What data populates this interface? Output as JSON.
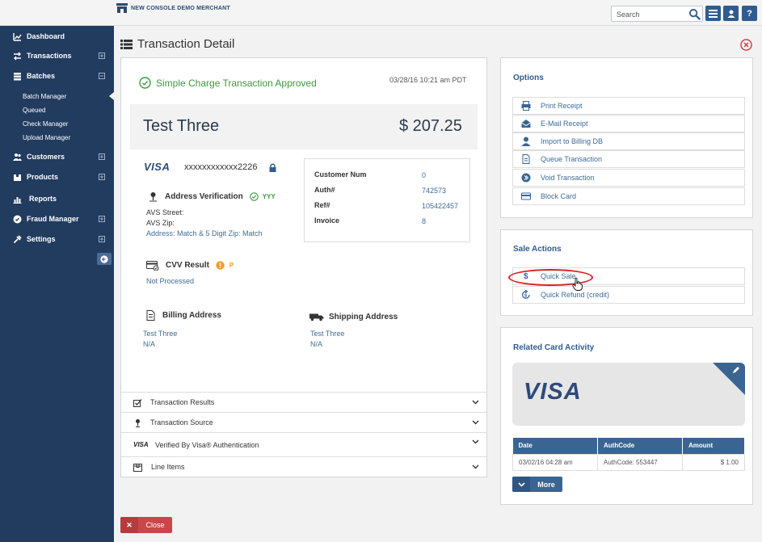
{
  "app": {
    "merchant_name": "NEW CONSOLE DEMO MERCHANT",
    "search_placeholder": "Search"
  },
  "sidebar": {
    "items": [
      {
        "label": "Dashboard",
        "icon": "chart-icon"
      },
      {
        "label": "Transactions",
        "icon": "arrows-icon"
      },
      {
        "label": "Batches",
        "icon": "stack-icon"
      },
      {
        "label": "Customers",
        "icon": "users-icon"
      },
      {
        "label": "Products",
        "icon": "box-icon"
      },
      {
        "label": "Reports",
        "icon": "bar-chart-icon"
      },
      {
        "label": "Fraud Manager",
        "icon": "shield-icon"
      },
      {
        "label": "Settings",
        "icon": "wrench-icon"
      }
    ],
    "batch_sub_items": [
      "Batch Manager",
      "Queued",
      "Check Manager",
      "Upload Manager"
    ]
  },
  "page": {
    "title": "Transaction Detail"
  },
  "transaction": {
    "status": "Simple Charge Transaction Approved",
    "timestamp": "03/28/16 10:21 am PDT",
    "customer_name": "Test Three",
    "amount": "$ 207.25",
    "card_brand": "VISA",
    "card_number": "xxxxxxxxxxxx2226",
    "address_verification": {
      "title": "Address Verification",
      "code": "YYY",
      "street_label": "AVS Street:",
      "zip_label": "AVS Zip:",
      "result": "Address: Match & 5 Digit Zip: Match"
    },
    "cvv": {
      "title": "CVV Result",
      "code": "P",
      "result": "Not Processed"
    },
    "billing": {
      "title": "Billing Address",
      "name": "Test  Three",
      "line2": "N/A"
    },
    "shipping": {
      "title": "Shipping Address",
      "name": "Test  Three",
      "line2": "N/A"
    },
    "info": [
      {
        "label": "Customer Num",
        "value": "0"
      },
      {
        "label": "Auth#",
        "value": "742573"
      },
      {
        "label": "Ref#",
        "value": "105422457"
      },
      {
        "label": "Invoice",
        "value": "8"
      }
    ],
    "accordion": [
      {
        "label": "Transaction Results",
        "icon": "checkbox-icon"
      },
      {
        "label": "Transaction Source",
        "icon": "pin-icon"
      },
      {
        "label": "Verified By Visa® Authentication",
        "icon": "visa-icon"
      },
      {
        "label": "Line Items",
        "icon": "box-icon"
      }
    ],
    "close_label": "Close"
  },
  "options": {
    "title": "Options",
    "items": [
      {
        "label": "Print Receipt",
        "icon": "printer-icon"
      },
      {
        "label": "E-Mail Receipt",
        "icon": "envelope-icon"
      },
      {
        "label": "Import to Billing DB",
        "icon": "user-icon"
      },
      {
        "label": "Queue Transaction",
        "icon": "document-icon"
      },
      {
        "label": "Void Transaction",
        "icon": "void-icon"
      },
      {
        "label": "Block Card",
        "icon": "card-icon"
      }
    ]
  },
  "sale_actions": {
    "title": "Sale Actions",
    "items": [
      {
        "label": "Quick Sale",
        "icon": "dollar-icon"
      },
      {
        "label": "Quick Refund (credit)",
        "icon": "refund-icon"
      }
    ]
  },
  "related": {
    "title": "Related Card Activity",
    "card_brand": "VISA",
    "columns": [
      "Date",
      "AuthCode",
      "Amount"
    ],
    "rows": [
      {
        "date": "03/02/16 04:28 am",
        "authcode": "AuthCode: 553447",
        "amount": "$ 1.00"
      }
    ],
    "more_label": "More"
  },
  "colors": {
    "sidebar": "#223c60",
    "accent": "#2f5c8f",
    "approved": "#3c9a3c",
    "danger": "#c9474a"
  }
}
